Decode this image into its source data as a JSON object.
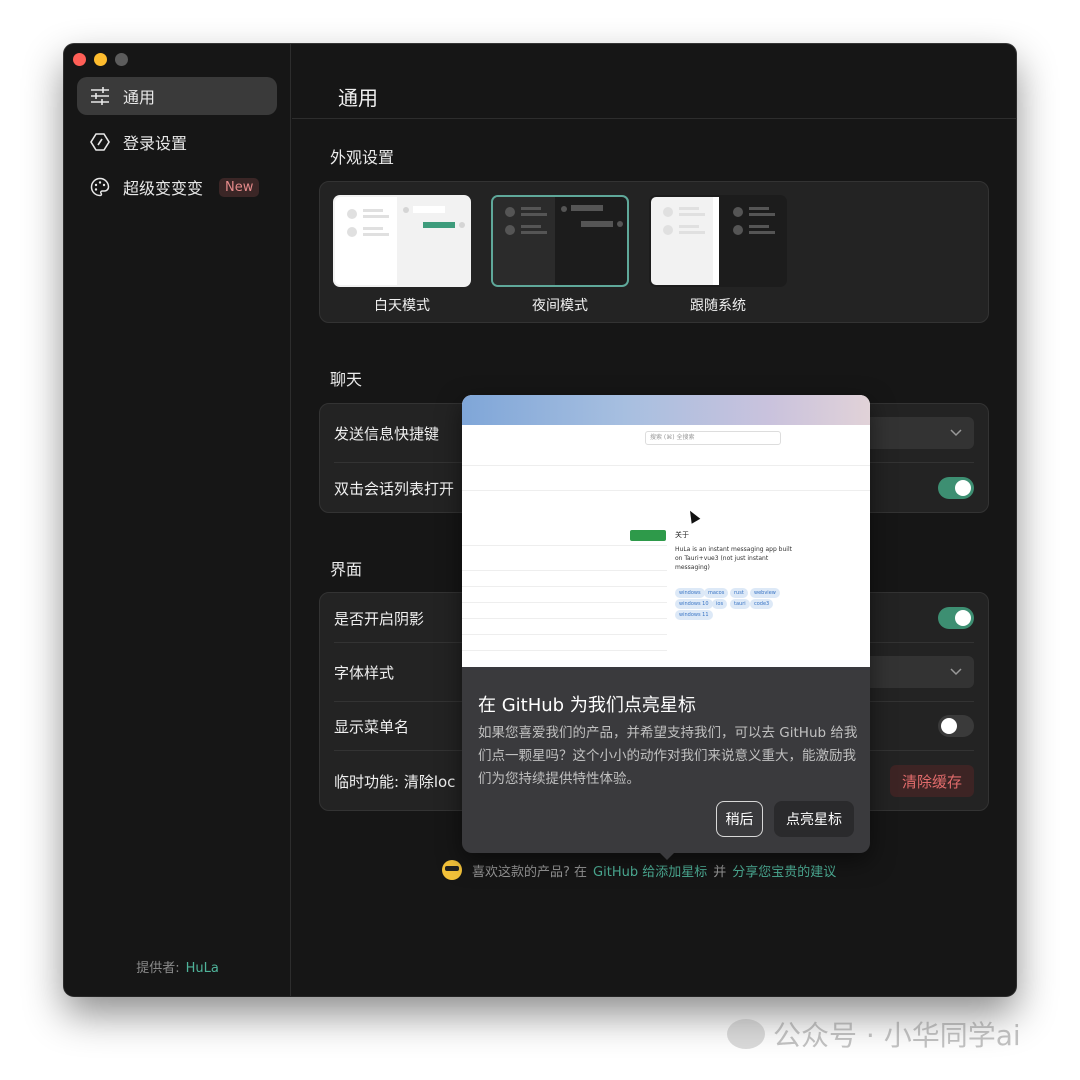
{
  "window": {
    "traffic_lights": [
      "close",
      "minimize",
      "zoom"
    ]
  },
  "sidebar": {
    "items": [
      {
        "label": "通用",
        "icon": "sliders-icon",
        "active": true
      },
      {
        "label": "登录设置",
        "icon": "hexagon-icon",
        "active": false
      },
      {
        "label": "超级变变变",
        "icon": "palette-icon",
        "active": false,
        "badge": "New"
      }
    ],
    "provider_label": "提供者:",
    "provider_link": "HuLa"
  },
  "main": {
    "title": "通用",
    "appearance": {
      "title": "外观设置",
      "themes": [
        {
          "label": "白天模式",
          "selected": false
        },
        {
          "label": "夜间模式",
          "selected": true
        },
        {
          "label": "跟随系统",
          "selected": false
        }
      ]
    },
    "chat": {
      "title": "聊天",
      "rows": [
        {
          "label": "发送信息快捷键",
          "control": "select"
        },
        {
          "label": "双击会话列表打开",
          "control": "toggle",
          "on": true
        }
      ]
    },
    "interface": {
      "title": "界面",
      "rows": [
        {
          "label": "是否开启阴影",
          "control": "toggle",
          "on": true
        },
        {
          "label": "字体样式",
          "control": "select"
        },
        {
          "label": "显示菜单名",
          "control": "toggle",
          "on": false
        },
        {
          "label": "临时功能: 清除loc",
          "control": "button",
          "button_label": "清除缓存"
        }
      ]
    },
    "footer": {
      "prefix": "喜欢这款的产品? 在",
      "link1": "GitHub 给添加星标",
      "middle": "并",
      "link2": "分享您宝贵的建议"
    }
  },
  "popup": {
    "title": "在 GitHub 为我们点亮星标",
    "body": "如果您喜爱我们的产品，并希望支持我们，可以去 GitHub 给我们点一颗星吗？这个小小的动作对我们来说意义重大，能激励我们为您持续提供特性体验。",
    "later_label": "稍后",
    "star_label": "点亮星标",
    "preview": {
      "search": "搜索 (⌘) 全搜索",
      "about_title": "关于",
      "about_text": "HuLa is an instant messaging app built on Tauri+vue3 (not just instant messaging)",
      "tags": [
        "windows",
        "macos",
        "rust",
        "webview",
        "windows 10",
        "ios",
        "tauri",
        "code3",
        "windows 11"
      ]
    }
  },
  "watermark": "公众号 · 小华同学ai",
  "colors": {
    "accent": "#3d8f72",
    "link": "#4fb39a",
    "danger": "#e06b6b"
  }
}
